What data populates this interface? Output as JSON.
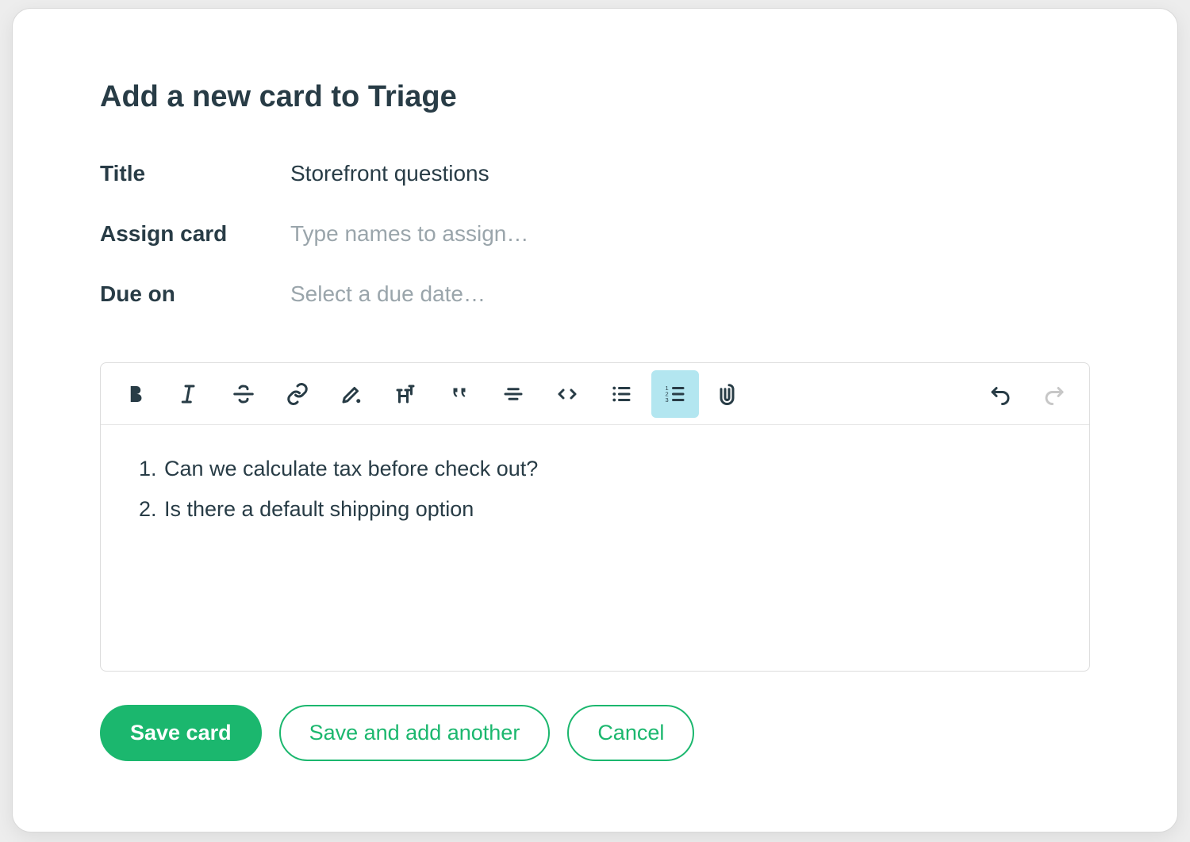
{
  "modal": {
    "title": "Add a new card to Triage"
  },
  "fields": {
    "title_label": "Title",
    "title_value": "Storefront questions",
    "assign_label": "Assign card",
    "assign_placeholder": "Type names to assign…",
    "assign_value": "",
    "due_label": "Due on",
    "due_placeholder": "Select a due date…",
    "due_value": ""
  },
  "description": {
    "items": [
      "Can we calculate tax before check out?",
      "Is there a default shipping option"
    ]
  },
  "buttons": {
    "save": "Save card",
    "save_another": "Save and add another",
    "cancel": "Cancel"
  }
}
